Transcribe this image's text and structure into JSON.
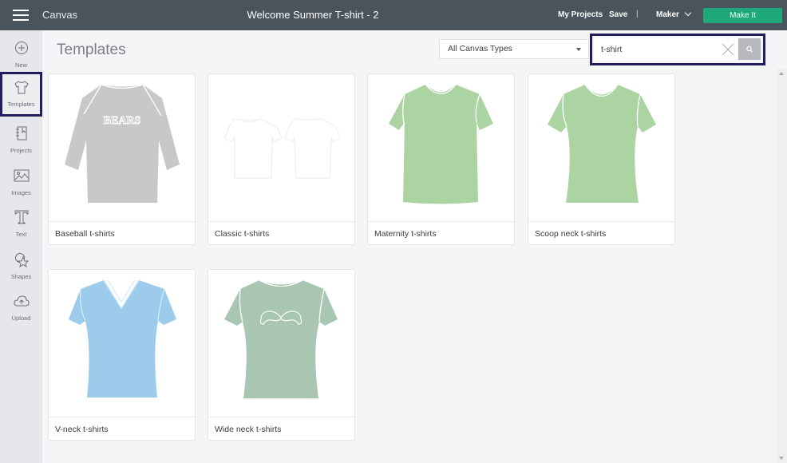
{
  "topbar": {
    "app_name": "Canvas",
    "document_title": "Welcome Summer T-shirt - 2",
    "my_projects": "My Projects",
    "save": "Save",
    "separator": "|",
    "machine": "Maker",
    "make_it": "Make It",
    "colors": {
      "bar": "#4b545c",
      "make_it": "#1fa87a"
    }
  },
  "sidebar": {
    "items": [
      {
        "label": "New",
        "icon": "plus-circle-icon"
      },
      {
        "label": "Templates",
        "icon": "tshirt-icon",
        "active": true
      },
      {
        "label": "Projects",
        "icon": "notebook-icon"
      },
      {
        "label": "Images",
        "icon": "image-icon"
      },
      {
        "label": "Text",
        "icon": "text-t-icon"
      },
      {
        "label": "Shapes",
        "icon": "shapes-icon"
      },
      {
        "label": "Upload",
        "icon": "cloud-upload-icon"
      }
    ]
  },
  "main": {
    "title": "Templates",
    "filter": {
      "selected": "All Canvas Types"
    },
    "search": {
      "value": "t-shirt",
      "placeholder": ""
    },
    "templates": [
      {
        "label": "Baseball t-shirts",
        "shirt_color": "#c8c8ca",
        "graphic": "BEARS"
      },
      {
        "label": "Classic t-shirts",
        "shirt_color": "#ffffff"
      },
      {
        "label": "Maternity t-shirts",
        "shirt_color": "#acd4a3"
      },
      {
        "label": "Scoop neck t-shirts",
        "shirt_color": "#acd4a3"
      },
      {
        "label": "V-neck t-shirts",
        "shirt_color": "#9ccbeb"
      },
      {
        "label": "Wide neck t-shirts",
        "shirt_color": "#a9c6b3"
      }
    ]
  }
}
